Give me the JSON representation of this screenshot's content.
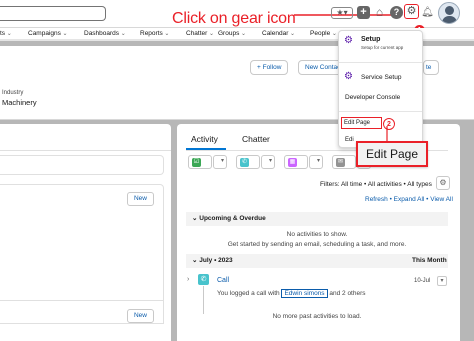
{
  "annotations": {
    "step1_text": "Click on gear icon",
    "step1_badge": "1",
    "step2_badge": "2",
    "step2_callout": "Edit Page",
    "accent_color": "#ea2028"
  },
  "header": {
    "icons": [
      "favorites-star-icon",
      "global-actions-plus-icon",
      "trailhead-icon",
      "help-icon",
      "setup-gear-icon",
      "notifications-bell-icon",
      "user-avatar"
    ]
  },
  "nav": {
    "items": [
      "ts",
      "Campaigns",
      "Dashboards",
      "Reports",
      "Chatter",
      "Groups",
      "Calendar",
      "People"
    ]
  },
  "record": {
    "follow_button": "+ Follow",
    "new_contact_button": "New Contac",
    "edit_button_partial": "te",
    "industry_label": "Industry",
    "industry_value": "Machinery"
  },
  "left": {
    "new_button_1": "New",
    "new_button_2": "New"
  },
  "activity": {
    "tab_activity": "Activity",
    "tab_chatter": "Chatter",
    "filters_text": "Filters: All time • All activities • All types",
    "links_text": "Refresh • Expand All • View All",
    "upcoming_header": "Upcoming & Overdue",
    "no_activities": "No activities to show.",
    "get_started": "Get started by sending an email, scheduling a task, and more.",
    "month_header": "July • 2023",
    "month_label": "This Month",
    "call_title": "Call",
    "call_date": "10-Jul",
    "call_desc_prefix": "You logged a call with",
    "call_contact": "Edwin simons",
    "call_desc_suffix": "and 2 others",
    "no_past": "No more past activities to load."
  },
  "menu": {
    "setup_label": "Setup",
    "setup_sub": "Setup for current app",
    "service_setup": "Service Setup",
    "developer_console": "Developer Console",
    "edit_page": "Edit Page",
    "edit_object_partial": "Edi"
  }
}
